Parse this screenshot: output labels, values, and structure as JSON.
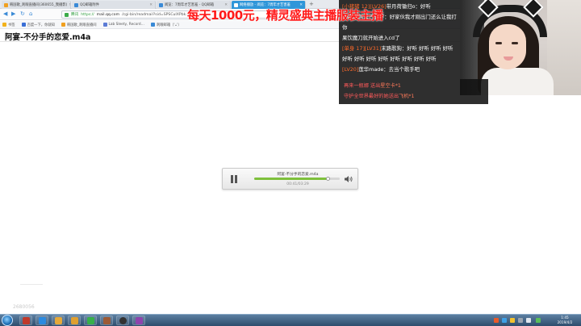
{
  "browser": {
    "tabs": [
      {
        "label": "韩国歌_刺眼直播间(360655_我播影)",
        "color": "#f0a020"
      },
      {
        "label": "QQ邮箱附件",
        "color": "#3a8ad6"
      },
      {
        "label": "阅览：7周年才艺害羞 - QQ邮箱",
        "color": "#3a8ad6"
      },
      {
        "label": "网络播放 - 阅览：7周年才艺害羞",
        "color": "#ffffff"
      }
    ],
    "new_tab": "+",
    "nav": {
      "back": "◀",
      "forward": "▶",
      "refresh": "↻",
      "home": "⌂"
    },
    "url": {
      "secure_label": "腾讯",
      "scheme": "https://",
      "host": "mail.qq.com",
      "rest": "/cgi-bin/readmail?sid=SPSCuIXPbk…"
    },
    "bookmarks": [
      "书签",
      "百度一下，你就知",
      "韩国歌_刺眼直播间",
      "Lab Sleety, Record…",
      "刺眼邮箱（'ᴗ'）"
    ]
  },
  "page": {
    "title": "阿宴-不分手的恋爱.m4a"
  },
  "player": {
    "track": "阿宴-不分手的恋爱.m4a",
    "time": "00:41/03:29",
    "progress": 0.87
  },
  "overlay": {
    "banner": "每天1000元，精灵盛典主播服装主播",
    "chat": [
      {
        "level": "[小猪猪 12][LV26]",
        "text": "带月荷锄归o：好听"
      },
      {
        "level": "",
        "text": "[LV21]阿里巴天下：好家伙我才刚出门还么让我打你"
      },
      {
        "level": "",
        "text": "果饮魔刀就开始进入cd了"
      },
      {
        "level": "[单身 17][LV31]",
        "text": "末路歌狗：好听 好听 好听 好听 好听 好听 好听 好听 好听 好听 好听 好听"
      },
      {
        "level": "[LV20]",
        "text": "莲华made：去当个歌手吧"
      }
    ],
    "gifts": [
      {
        "user": "再来一瓶娜",
        "action": "送出",
        "item": "星空卡*1"
      },
      {
        "user": "守护全世界最好的她",
        "action": "送出",
        "item": "飞机*1"
      }
    ]
  },
  "desktop": {
    "watermark": "2680056",
    "clock_time": "1:45",
    "clock_date": "2019/4/2",
    "taskbar_apps": [
      {
        "name": "media-player",
        "color": "#c0392b"
      },
      {
        "name": "ie",
        "color": "#2b8ae0"
      },
      {
        "name": "folder",
        "color": "#e6a93a"
      },
      {
        "name": "qq-browser",
        "color": "#e0a030"
      },
      {
        "name": "qq-music",
        "color": "#38b04a"
      },
      {
        "name": "tools",
        "color": "#9c5a36"
      },
      {
        "name": "obs",
        "color": "#333333"
      },
      {
        "name": "game",
        "color": "#8e44ad"
      }
    ]
  }
}
